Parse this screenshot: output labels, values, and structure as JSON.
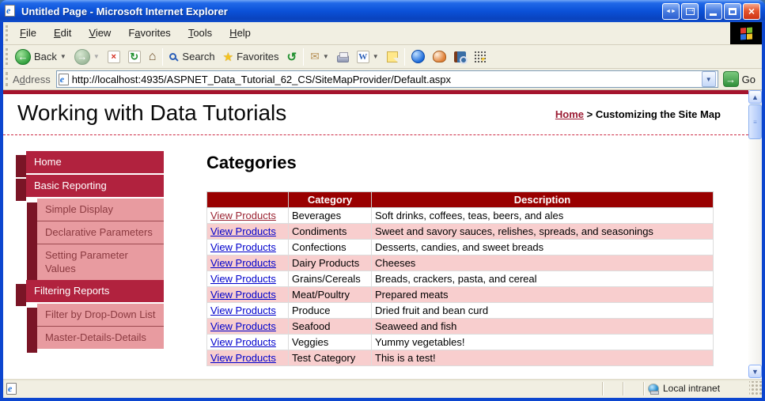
{
  "window": {
    "title": "Untitled Page - Microsoft Internet Explorer"
  },
  "menu": {
    "items": [
      {
        "label": "File",
        "accel": 0
      },
      {
        "label": "Edit",
        "accel": 0
      },
      {
        "label": "View",
        "accel": 0
      },
      {
        "label": "Favorites",
        "accel": 1
      },
      {
        "label": "Tools",
        "accel": 0
      },
      {
        "label": "Help",
        "accel": 0
      }
    ]
  },
  "toolbar": {
    "back_label": "Back",
    "search_label": "Search",
    "favorites_label": "Favorites",
    "word_glyph": "W"
  },
  "address": {
    "label": "Address",
    "accel": 1,
    "url": "http://localhost:4935/ASPNET_Data_Tutorial_62_CS/SiteMapProvider/Default.aspx",
    "go_label": "Go"
  },
  "page": {
    "site_title": "Working with Data Tutorials",
    "breadcrumb": {
      "home": "Home",
      "separator": ">",
      "current": "Customizing the Site Map"
    },
    "heading": "Categories",
    "sidebar": {
      "items": [
        {
          "label": "Home",
          "level": 1
        },
        {
          "label": "Basic Reporting",
          "level": 1
        },
        {
          "label": "Simple Display",
          "level": 2
        },
        {
          "label": "Declarative Parameters",
          "level": 2
        },
        {
          "label": "Setting Parameter Values",
          "level": 2
        },
        {
          "label": "Filtering Reports",
          "level": 1
        },
        {
          "label": "Filter by Drop-Down List",
          "level": 2
        },
        {
          "label": "Master-Details-Details",
          "level": 2
        }
      ]
    },
    "table": {
      "link_label": "View Products",
      "headers": [
        "",
        "Category",
        "Description"
      ],
      "rows": [
        {
          "category": "Beverages",
          "description": "Soft drinks, coffees, teas, beers, and ales",
          "visited": true
        },
        {
          "category": "Condiments",
          "description": "Sweet and savory sauces, relishes, spreads, and seasonings",
          "visited": false
        },
        {
          "category": "Confections",
          "description": "Desserts, candies, and sweet breads",
          "visited": false
        },
        {
          "category": "Dairy Products",
          "description": "Cheeses",
          "visited": false
        },
        {
          "category": "Grains/Cereals",
          "description": "Breads, crackers, pasta, and cereal",
          "visited": false
        },
        {
          "category": "Meat/Poultry",
          "description": "Prepared meats",
          "visited": false
        },
        {
          "category": "Produce",
          "description": "Dried fruit and bean curd",
          "visited": false
        },
        {
          "category": "Seafood",
          "description": "Seaweed and fish",
          "visited": false
        },
        {
          "category": "Veggies",
          "description": "Yummy vegetables!",
          "visited": false
        },
        {
          "category": "Test Category",
          "description": "This is a test!",
          "visited": false
        }
      ]
    }
  },
  "statusbar": {
    "zone_label": "Local intranet"
  },
  "colors": {
    "title_bar_blue": "#0b51d8",
    "chrome_tan": "#f1efe2",
    "accent_crimson": "#b1223e",
    "accent_dark_maroon": "#7a1526",
    "accent_pink": "#e89ba0",
    "page_top_bar": "#a5142d",
    "table_header_red": "#990000",
    "table_alt_pink": "#f8cece",
    "link_blue": "#0000cc",
    "link_visited_maroon": "#9b2433",
    "breadcrumb_link": "#9b1b33"
  }
}
